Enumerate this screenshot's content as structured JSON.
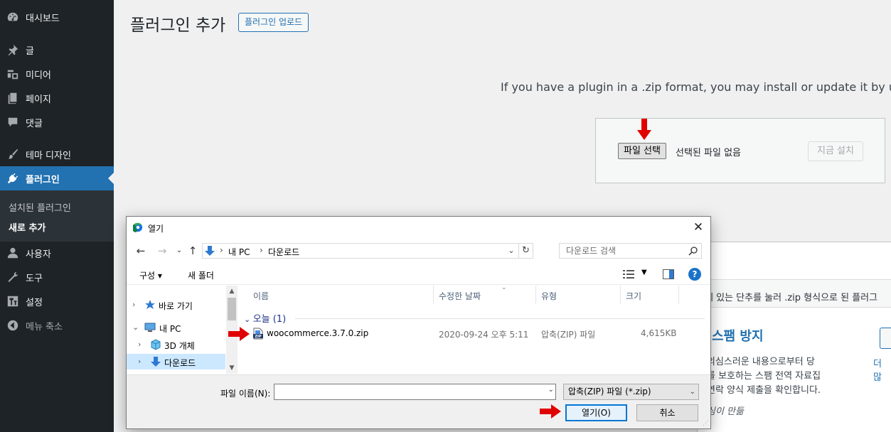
{
  "sidebar": {
    "items": [
      {
        "label": "대시보드",
        "icon": "dashboard-icon"
      },
      {
        "label": "글",
        "icon": "pin-icon"
      },
      {
        "label": "미디어",
        "icon": "media-icon"
      },
      {
        "label": "페이지",
        "icon": "page-icon"
      },
      {
        "label": "댓글",
        "icon": "comment-icon"
      },
      {
        "label": "테마 디자인",
        "icon": "brush-icon"
      },
      {
        "label": "플러그인",
        "icon": "plugin-icon"
      },
      {
        "label": "사용자",
        "icon": "user-icon"
      },
      {
        "label": "도구",
        "icon": "wrench-icon"
      },
      {
        "label": "설정",
        "icon": "settings-icon"
      },
      {
        "label": "메뉴 축소",
        "icon": "collapse-icon"
      }
    ],
    "submenu": [
      {
        "label": "설치된 플러그인"
      },
      {
        "label": "새로 추가"
      }
    ]
  },
  "main": {
    "title": "플러그인 추가",
    "upload_button": "플러그인 업로드",
    "help_text": "If you have a plugin in a .zip format, you may install or update it by up",
    "file_button": "파일 선택",
    "file_status": "선택된 파일 없음",
    "install_button": "지금 설치"
  },
  "background_panel": {
    "strip_text": "에 있는 단추를 눌러 .zip 형식으로 된 플러그",
    "plugin_title": "스팸 방지",
    "desc_lines": [
      "의심스러운 내용으로부터 당",
      "를 보호하는 스팸 전역 자료집",
      "연락 양식 제출을 확인합니다."
    ],
    "author": "심이 만듦",
    "more_link": "더 많"
  },
  "dialog": {
    "title": "열기",
    "breadcrumbs": [
      "내 PC",
      "다운로드"
    ],
    "search_placeholder": "다운로드 검색",
    "toolbar": {
      "organize": "구성 ▾",
      "new_folder": "새 폴더"
    },
    "tree": [
      {
        "label": "바로 가기",
        "chevron": "›",
        "icon": "star-icon"
      },
      {
        "label": "내 PC",
        "chevron": "⌄",
        "icon": "pc-icon"
      },
      {
        "label": "3D 개체",
        "chevron": "›",
        "icon": "cube-icon"
      },
      {
        "label": "다운로드",
        "chevron": "›",
        "icon": "download-icon"
      }
    ],
    "columns": [
      "이름",
      "수정한 날짜",
      "유형",
      "크기"
    ],
    "group": "오늘 (1)",
    "files": [
      {
        "name": "woocommerce.3.7.0.zip",
        "date": "2020-09-24 오후 5:11",
        "type": "압축(ZIP) 파일",
        "size": "4,615KB"
      }
    ],
    "filename_label": "파일 이름(N):",
    "filename_value": "",
    "filetype": "압축(ZIP) 파일 (*.zip)",
    "open_button": "열기(O)",
    "cancel_button": "취소"
  },
  "colors": {
    "sidebar_bg": "#1d2327",
    "accent": "#2271b1",
    "arrow": "#e00000",
    "selection": "#cce8ff"
  }
}
